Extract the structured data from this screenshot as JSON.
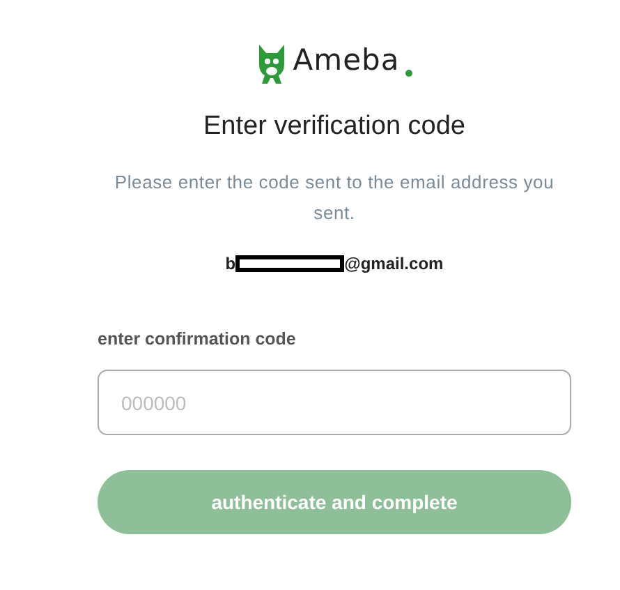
{
  "logo": {
    "text": "Ameba"
  },
  "title": "Enter verification code",
  "description": "Please enter the code sent to the email address you sent.",
  "email": {
    "prefix": "b",
    "redacted": true,
    "suffix": "@gmail.com"
  },
  "code_field": {
    "label": "enter confirmation code",
    "placeholder": "000000"
  },
  "submit_button": {
    "label": "authenticate and complete",
    "disabled": true
  }
}
